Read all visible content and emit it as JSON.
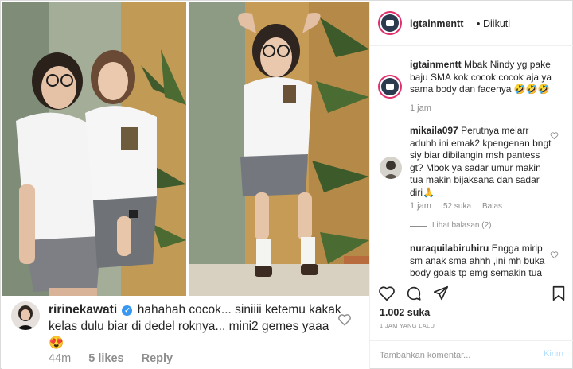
{
  "post": {
    "username": "igtainmentt",
    "separator": "•",
    "follow_status": "Diikuti",
    "caption_user": "igtainmentt",
    "caption_text": "Mbak Nindy yg pake baju SMA kok cocok cocok aja ya sama body dan facenya 🤣🤣🤣",
    "caption_time": "1 jam",
    "likes": "1.002 suka",
    "posted_ago": "1 JAM YANG LALU"
  },
  "comments": [
    {
      "user": "mikaila097",
      "text": "Perutnya melarr aduhh ini emak2 kpengenan bngt siy biar dibilangin msh pantess gt? Mbok ya sadar umur makin tua makin bijaksana dan sadar diri🙏",
      "time": "1 jam",
      "likes": "52 suka",
      "reply": "Balas",
      "view_replies": "Lihat balasan (2)"
    },
    {
      "user": "nuraquilabiruhiru",
      "text": "Engga mirip sm anak sma ahhh ,ini mh buka body goals tp emg semakin tua"
    }
  ],
  "add_comment": {
    "placeholder": "Tambahkan komentar...",
    "send_label": "Kirim"
  },
  "overlay_comment": {
    "user": "ririnekawati",
    "verified_mark": "✓",
    "text": " hahahah cocok... siniiii ketemu kakak kelas dulu biar di dedel roknya... mini2 gemes yaaa 😍",
    "time": "44m",
    "likes": "5 likes",
    "reply": "Reply"
  },
  "icons": {
    "like": "heart-icon",
    "comment": "comment-icon",
    "share": "share-icon",
    "save": "bookmark-icon"
  },
  "colors": {
    "border": "#dbdbdb",
    "muted": "#8e8e8e",
    "verified": "#3897f0",
    "story_ring": "#e1306c",
    "send_disabled": "#b2dffc"
  }
}
